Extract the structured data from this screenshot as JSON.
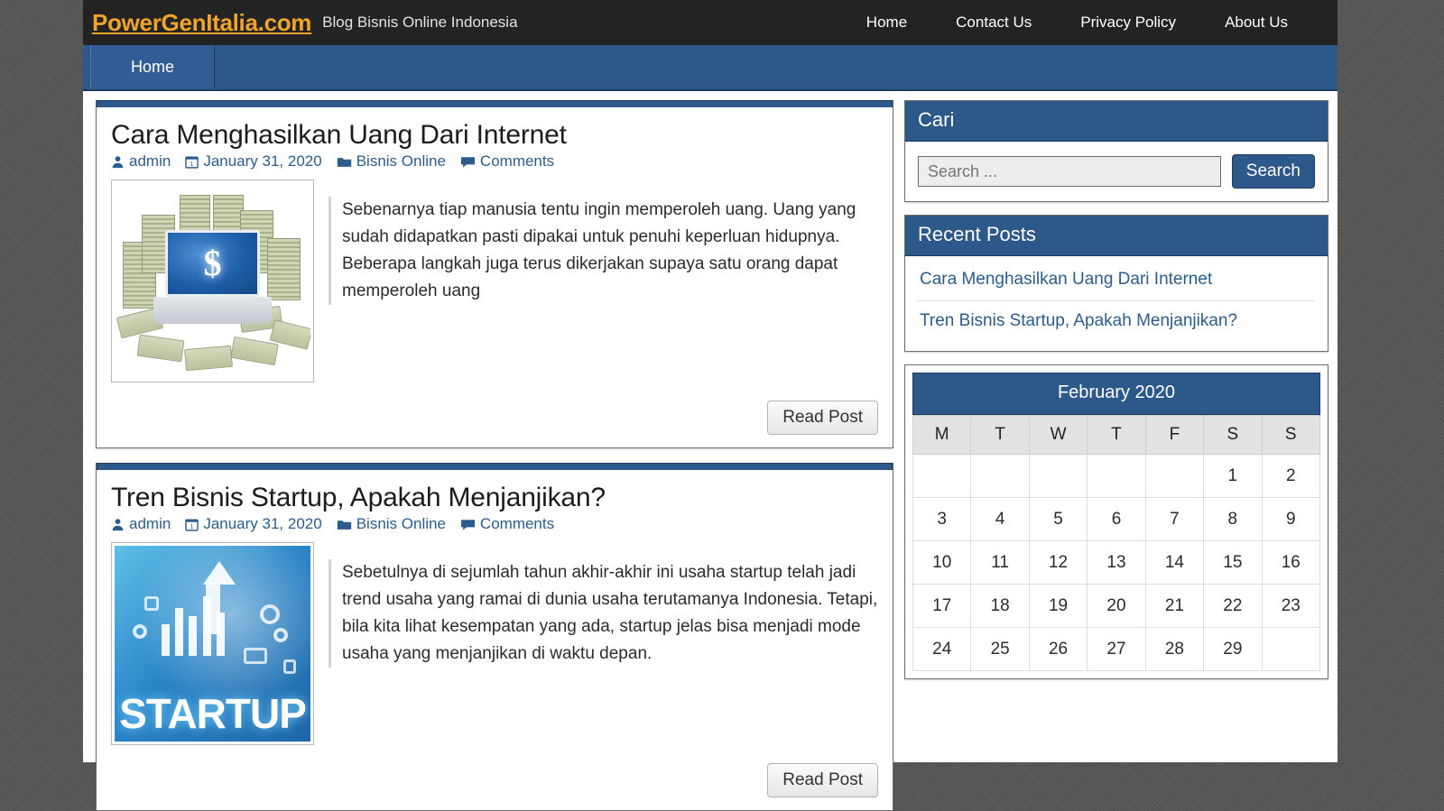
{
  "site": {
    "brand": "PowerGenItalia.com",
    "tagline": "Blog Bisnis Online Indonesia"
  },
  "topnav": {
    "items": [
      {
        "label": "Home"
      },
      {
        "label": "Contact Us"
      },
      {
        "label": "Privacy Policy"
      },
      {
        "label": "About Us"
      }
    ]
  },
  "menubar": {
    "items": [
      {
        "label": "Home"
      }
    ]
  },
  "colors": {
    "accent_blue": "#2d588a",
    "brand_orange": "#f0a52a",
    "masthead_dark": "#232323",
    "page_background": "#585858",
    "link_blue": "#2b5d8c"
  },
  "posts": [
    {
      "title": "Cara Menghasilkan Uang Dari Internet",
      "author": "admin",
      "date": "January 31, 2020",
      "category": "Bisnis Online",
      "comments": "Comments",
      "excerpt": "Sebenarnya tiap manusia tentu ingin memperoleh uang. Uang yang sudah didapatkan pasti dipakai untuk penuhi keperluan hidupnya. Beberapa langkah juga terus dikerjakan supaya satu orang dapat memperoleh uang",
      "read_more_label": "Read Post",
      "thumbnail_alt": "laptop-with-dollar-sign-and-money-stacks"
    },
    {
      "title": "Tren Bisnis Startup, Apakah Menjanjikan?",
      "author": "admin",
      "date": "January 31, 2020",
      "category": "Bisnis Online",
      "comments": "Comments",
      "excerpt": "Sebetulnya di sejumlah tahun akhir-akhir ini usaha startup telah jadi trend usaha yang ramai di dunia usaha terutamanya Indonesia. Tetapi, bila kita lihat kesempatan yang ada, startup jelas bisa menjadi mode usaha yang menjanjikan di waktu depan.",
      "read_more_label": "Read Post",
      "thumbnail_alt": "startup-infographic-banner",
      "thumbnail_word": "STARTUP"
    }
  ],
  "sidebar": {
    "search_widget": {
      "title": "Cari",
      "placeholder": "Search ...",
      "value": "",
      "button_label": "Search"
    },
    "recent_widget": {
      "title": "Recent Posts",
      "items": [
        {
          "label": "Cara Menghasilkan Uang Dari Internet"
        },
        {
          "label": "Tren Bisnis Startup, Apakah Menjanjikan?"
        }
      ]
    },
    "calendar": {
      "caption": "February 2020",
      "weekdays": [
        "M",
        "T",
        "W",
        "T",
        "F",
        "S",
        "S"
      ],
      "weeks": [
        [
          "",
          "",
          "",
          "",
          "",
          "1",
          "2"
        ],
        [
          "3",
          "4",
          "5",
          "6",
          "7",
          "8",
          "9"
        ],
        [
          "10",
          "11",
          "12",
          "13",
          "14",
          "15",
          "16"
        ],
        [
          "17",
          "18",
          "19",
          "20",
          "21",
          "22",
          "23"
        ],
        [
          "24",
          "25",
          "26",
          "27",
          "28",
          "29",
          ""
        ]
      ]
    }
  }
}
